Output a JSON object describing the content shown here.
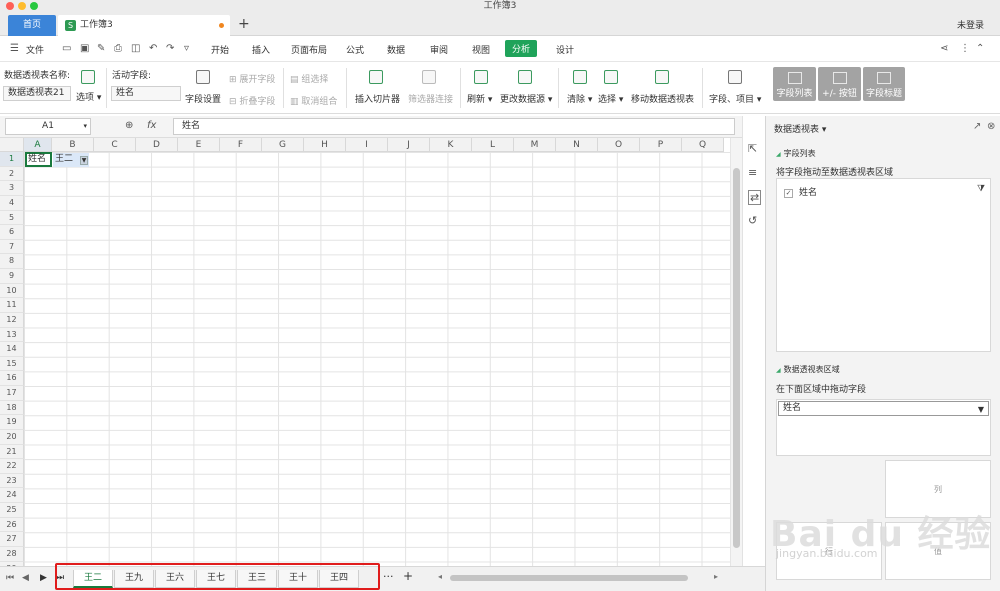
{
  "window": {
    "title": "工作簿3"
  },
  "tabs": {
    "home": "首页",
    "document": "工作簿3",
    "new_tab": "+",
    "login": "未登录"
  },
  "menu": {
    "file": "文件",
    "items": [
      "开始",
      "插入",
      "页面布局",
      "公式",
      "数据",
      "审阅",
      "视图",
      "分析",
      "设计"
    ],
    "active": "分析"
  },
  "ribbon": {
    "pivot_name_label": "数据透视表名称:",
    "pivot_name_value": "数据透视表21",
    "options": "选项",
    "active_field_label": "活动字段:",
    "active_field_value": "姓名",
    "field_settings": "字段设置",
    "expand_field": "展开字段",
    "collapse_field": "折叠字段",
    "group_selection": "组选择",
    "ungroup": "取消组合",
    "insert_slicer": "插入切片器",
    "filter_connections": "筛选器连接",
    "refresh": "刷新",
    "change_source": "更改数据源",
    "clear": "清除",
    "select": "选择",
    "move_pivot": "移动数据透视表",
    "fields_items": "字段、项目",
    "field_list": "字段列表",
    "plus_minus": "+/- 按钮",
    "field_headers": "字段标题"
  },
  "formula_bar": {
    "name_box": "A1",
    "fx": "fx",
    "value": "姓名"
  },
  "grid": {
    "columns": [
      "A",
      "B",
      "C",
      "D",
      "E",
      "F",
      "G",
      "H",
      "I",
      "J",
      "K",
      "L",
      "M",
      "N",
      "O",
      "P",
      "Q"
    ],
    "rows": [
      "1",
      "2",
      "3",
      "4",
      "5",
      "6",
      "7",
      "8",
      "9",
      "10",
      "11",
      "12",
      "13",
      "14",
      "15",
      "16",
      "17",
      "18",
      "19",
      "20",
      "21",
      "22",
      "23",
      "24",
      "25",
      "26",
      "27",
      "28",
      "29"
    ],
    "a1": "姓名",
    "b1": "王二",
    "b1_filter": "▼"
  },
  "sheets": {
    "tabs": [
      "王二",
      "王九",
      "王六",
      "王七",
      "王三",
      "王十",
      "王四"
    ],
    "active": "王二",
    "more": "···",
    "add": "+"
  },
  "panel": {
    "title": "数据透视表",
    "field_list_section": "字段列表",
    "drag_hint": "将字段拖动至数据透视表区域",
    "field_name": "姓名",
    "areas_section": "数据透视表区域",
    "areas_hint": "在下面区域中拖动字段",
    "filter_value": "姓名",
    "columns_label": "列",
    "rows_label": "行",
    "values_label": "值"
  },
  "watermark": {
    "main": "Bai du 经验",
    "sub": "jingyan.baidu.com"
  },
  "colors": {
    "accent_green": "#1fa35a",
    "home_blue": "#3b84d8",
    "highlight_red": "#e01c1c"
  }
}
